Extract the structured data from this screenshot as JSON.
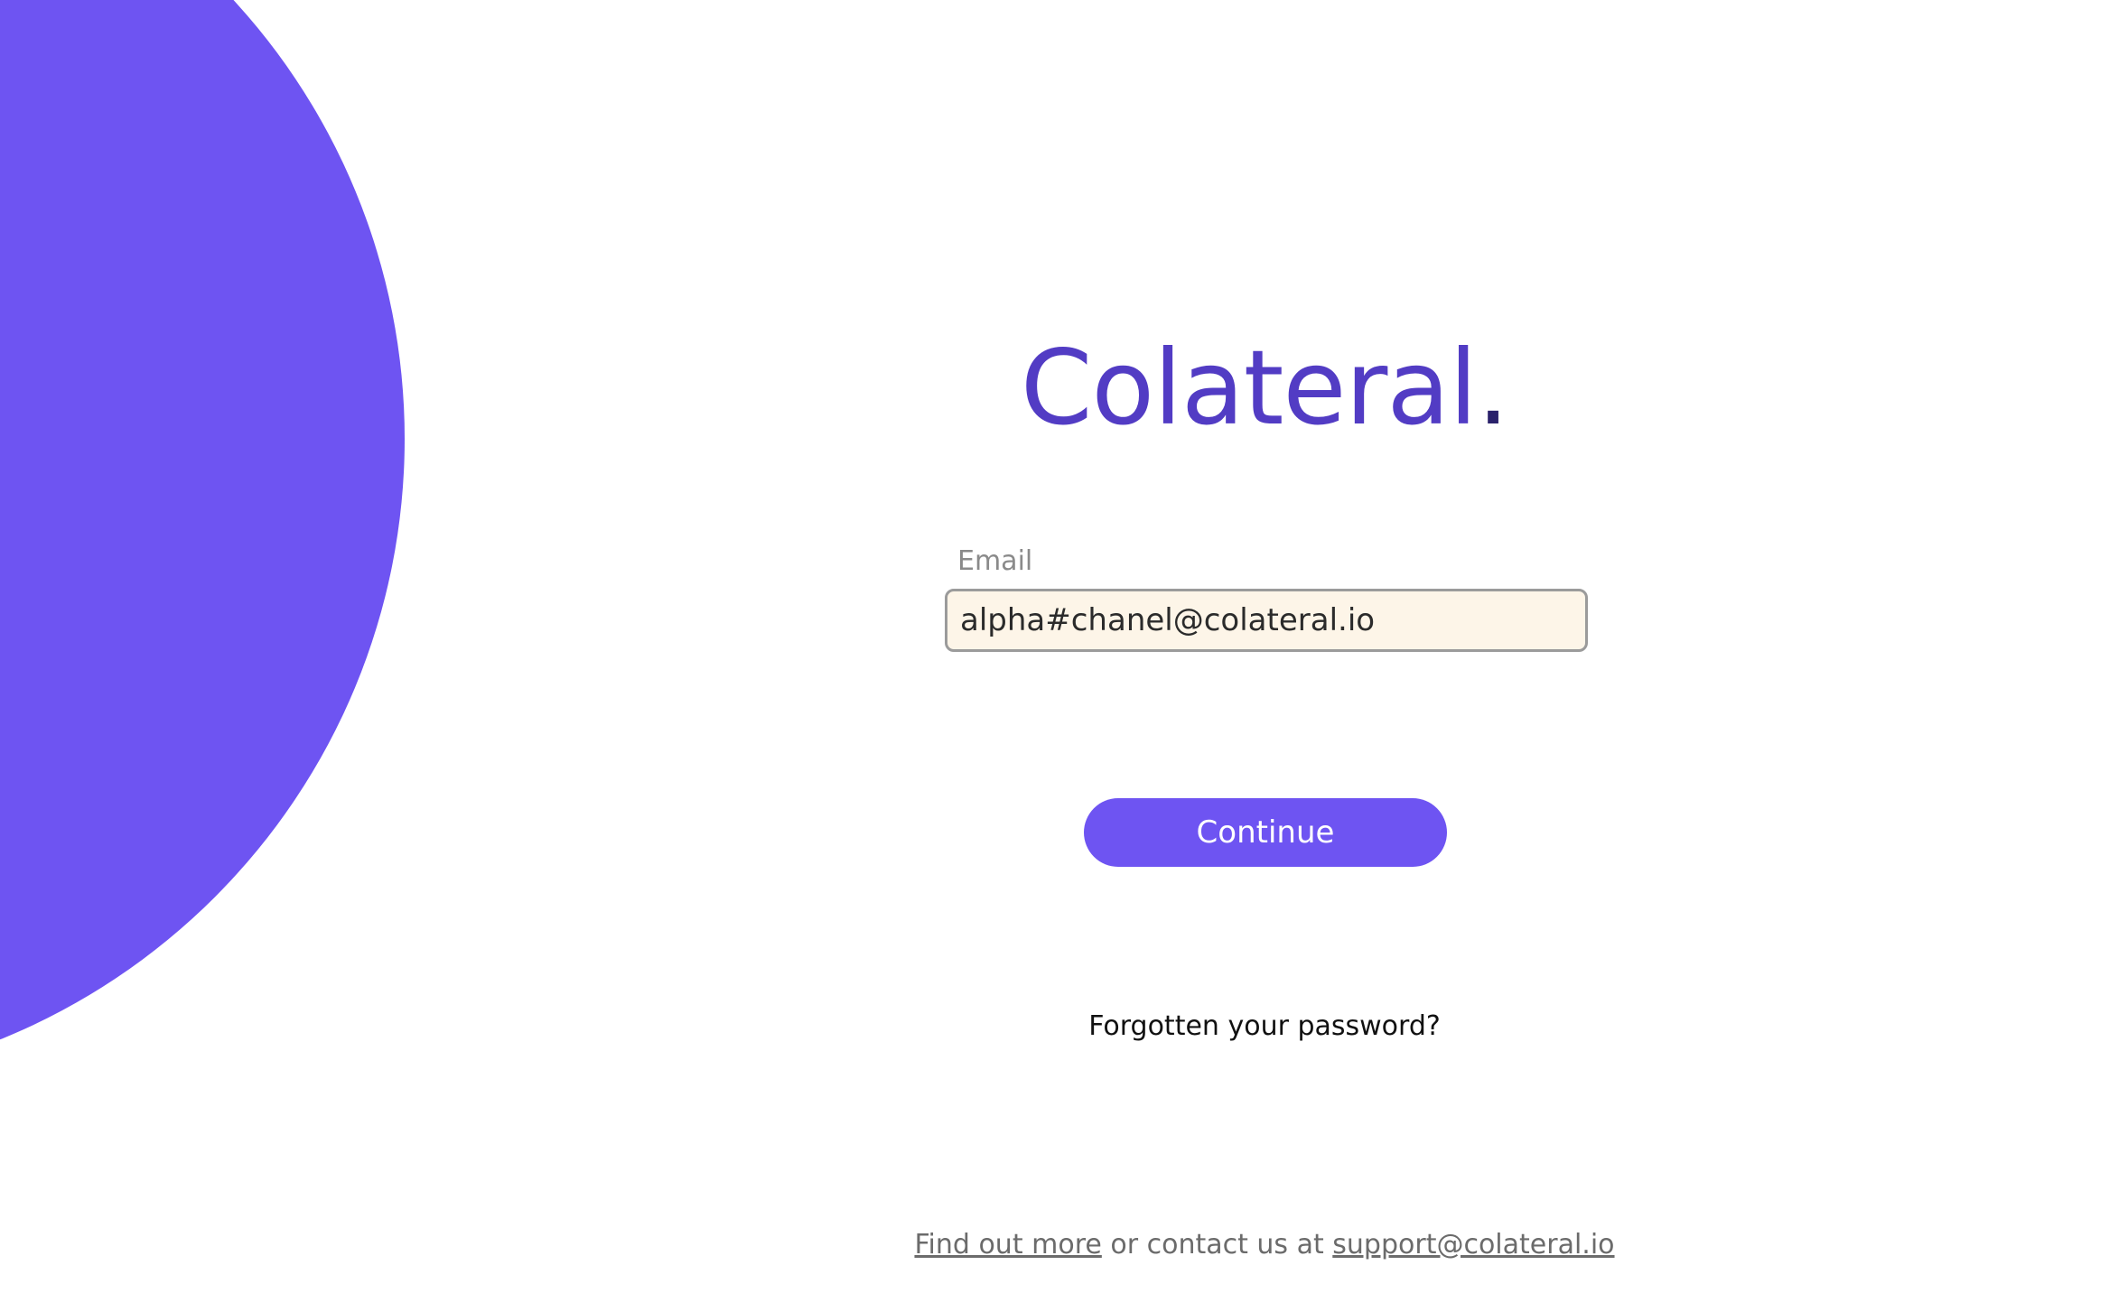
{
  "brand": {
    "logo_text": "Colateral",
    "logo_dot": ".",
    "primary_color": "#6e54f2",
    "logo_color": "#523cc4"
  },
  "login_form": {
    "email_label": "Email",
    "email_value": "alpha#chanel@colateral.io",
    "continue_label": "Continue",
    "forgot_password_label": "Forgotten your password?"
  },
  "footer": {
    "find_out_more_label": "Find out more",
    "middle_text": " or contact us at ",
    "support_email": "support@colateral.io"
  }
}
